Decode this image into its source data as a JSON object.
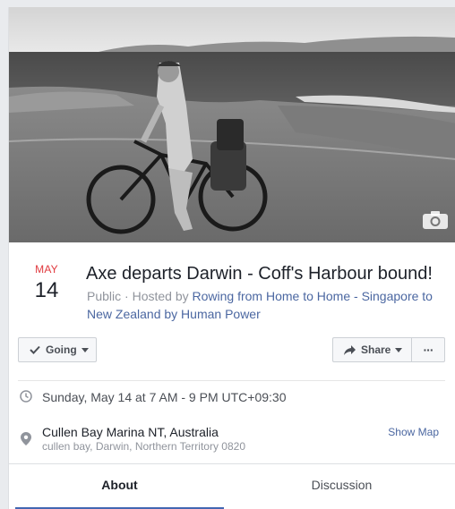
{
  "event": {
    "month": "MAY",
    "day": "14",
    "title": "Axe departs Darwin - Coff's Harbour bound!",
    "privacy": "Public",
    "hosted_by_prefix": " · Hosted by ",
    "host": "Rowing from Home to Home - Singapore to New Zealand by Human Power"
  },
  "actions": {
    "going_label": "Going",
    "share_label": "Share",
    "more_label": "···"
  },
  "details": {
    "datetime": "Sunday, May 14 at 7 AM - 9 PM UTC+09:30",
    "location_name": "Cullen Bay Marina NT, Australia",
    "location_address": "cullen bay, Darwin, Northern Territory 0820",
    "show_map_label": "Show Map"
  },
  "tabs": [
    {
      "label": "About"
    },
    {
      "label": "Discussion"
    }
  ],
  "icons": {
    "camera": "camera-icon",
    "check": "check-icon",
    "share": "share-arrow-icon",
    "clock": "clock-icon",
    "pin": "location-pin-icon"
  },
  "colors": {
    "month_red": "#e0393e",
    "link_blue": "#4b67a1",
    "tab_indicator": "#4267b2"
  }
}
